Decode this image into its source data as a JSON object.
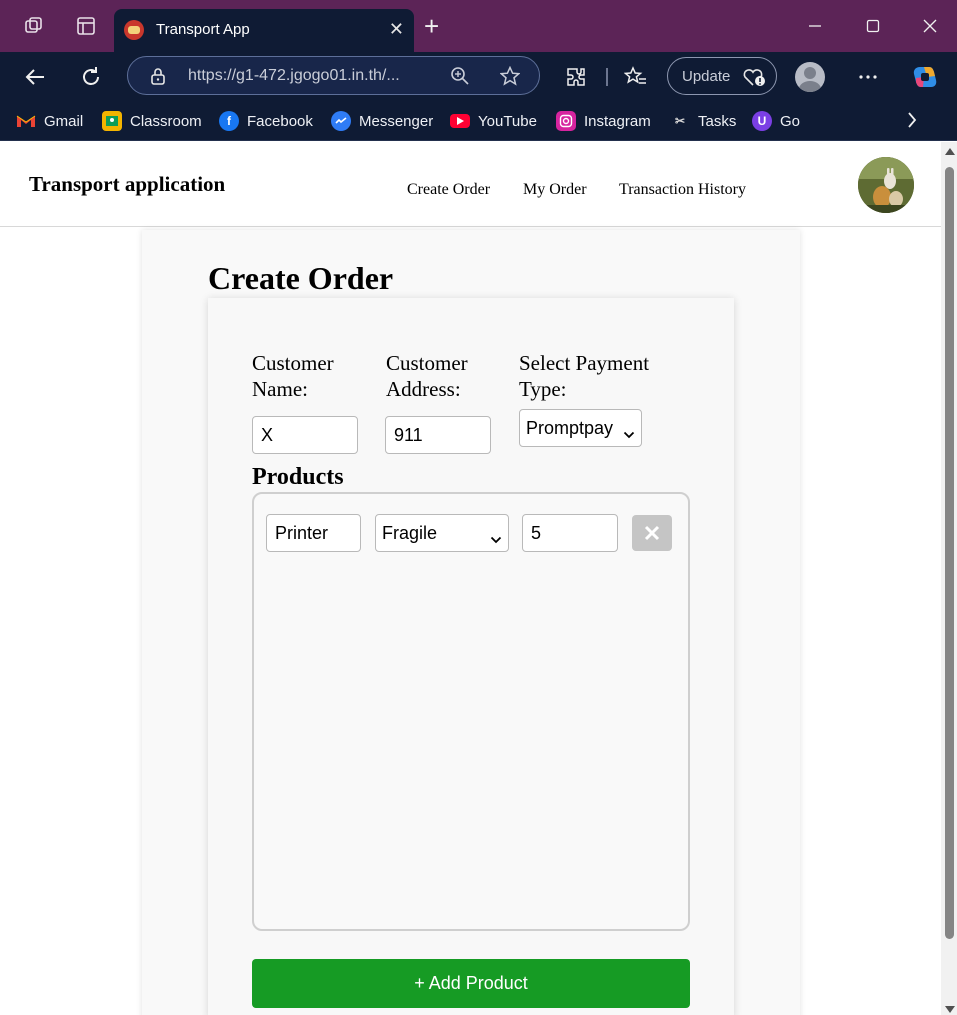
{
  "browser": {
    "tab_title": "Transport App",
    "url": "https://g1-472.jgogo01.in.th/...",
    "update_label": "Update",
    "bookmarks": [
      {
        "label": "Gmail",
        "icon": "gmail-icon"
      },
      {
        "label": "Classroom",
        "icon": "classroom-icon"
      },
      {
        "label": "Facebook",
        "icon": "facebook-icon"
      },
      {
        "label": "Messenger",
        "icon": "messenger-icon"
      },
      {
        "label": "YouTube",
        "icon": "youtube-icon"
      },
      {
        "label": "Instagram",
        "icon": "instagram-icon"
      },
      {
        "label": "Tasks",
        "icon": "tasks-icon"
      },
      {
        "label": "Go",
        "icon": "go-icon"
      }
    ]
  },
  "app": {
    "brand": "Transport application",
    "nav": [
      "Create Order",
      "My Order",
      "Transaction History"
    ]
  },
  "form": {
    "title": "Create Order",
    "customer_name_label": "Customer Name:",
    "customer_name_value": "X",
    "customer_address_label": "Customer Address:",
    "customer_address_value": "911",
    "payment_label": "Select Payment Type:",
    "payment_value": "Promptpay",
    "products_title": "Products",
    "products": [
      {
        "name": "Printer",
        "type": "Fragile",
        "quantity": "5"
      }
    ],
    "add_product_label": "+ Add Product"
  },
  "colors": {
    "titlebar": "#5c2457",
    "chrome": "#0f1b34",
    "add_button": "#169b24",
    "remove_button": "#c5c5c5"
  }
}
